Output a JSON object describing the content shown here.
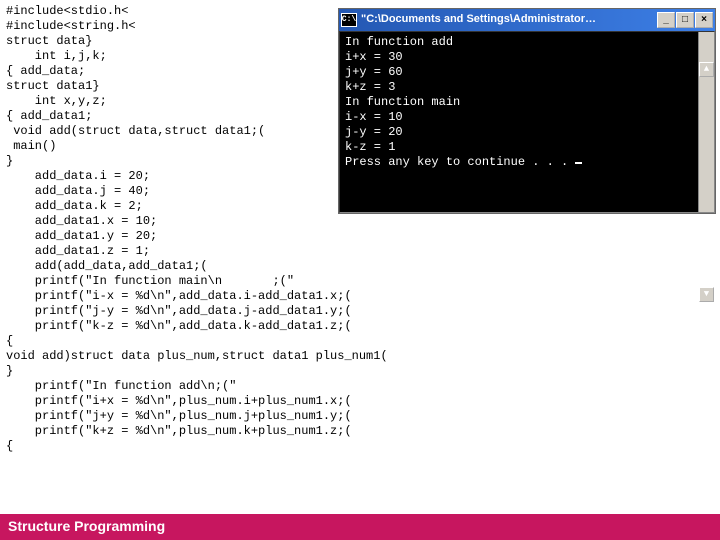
{
  "code": "#include<stdio.h<\n#include<string.h<\nstruct data}\n    int i,j,k;\n{ add_data;\nstruct data1}\n    int x,y,z;\n{ add_data1;\n void add(struct data,struct data1;(\n main()\n}\n    add_data.i = 20;\n    add_data.j = 40;\n    add_data.k = 2;\n    add_data1.x = 10;\n    add_data1.y = 20;\n    add_data1.z = 1;\n    add(add_data,add_data1;(\n    printf(\"In function main\\n       ;(\"\n    printf(\"i-x = %d\\n\",add_data.i-add_data1.x;(\n    printf(\"j-y = %d\\n\",add_data.j-add_data1.y;(\n    printf(\"k-z = %d\\n\",add_data.k-add_data1.z;(\n{\nvoid add)struct data plus_num,struct data1 plus_num1(\n}\n    printf(\"In function add\\n;(\"\n    printf(\"i+x = %d\\n\",plus_num.i+plus_num1.x;(\n    printf(\"j+y = %d\\n\",plus_num.j+plus_num1.y;(\n    printf(\"k+z = %d\\n\",plus_num.k+plus_num1.z;(\n{",
  "console": {
    "icon_label": "C:\\",
    "title": "\"C:\\Documents and Settings\\Administrator…",
    "minimize": "_",
    "maximize": "□",
    "close": "×",
    "output": "In function add\ni+x = 30\nj+y = 60\nk+z = 3\nIn function main\ni-x = 10\nj-y = 20\nk-z = 1\nPress any key to continue . . . "
  },
  "footer": "Structure Programming"
}
